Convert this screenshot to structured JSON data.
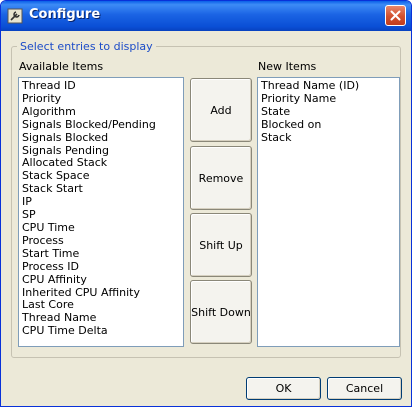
{
  "window": {
    "title": "Configure",
    "icon": "wrench-icon",
    "close_icon": "close-icon"
  },
  "group": {
    "legend": "Select entries to display"
  },
  "available": {
    "label": "Available Items",
    "items": [
      "Thread ID",
      "Priority",
      "Algorithm",
      "Signals Blocked/Pending",
      "Signals Blocked",
      "Signals Pending",
      "Allocated Stack",
      "Stack Space",
      "Stack Start",
      "IP",
      "SP",
      "CPU Time",
      "Process",
      "Start Time",
      "Process ID",
      "CPU Affinity",
      "Inherited CPU Affinity",
      "Last Core",
      "Thread Name",
      "CPU Time Delta"
    ]
  },
  "new_items": {
    "label": "New Items",
    "items": [
      "Thread Name (ID)",
      "Priority Name",
      "State",
      "Blocked on",
      "Stack"
    ]
  },
  "buttons": {
    "add": "Add",
    "remove": "Remove",
    "shift_up": "Shift Up",
    "shift_down": "Shift Down",
    "ok": "OK",
    "cancel": "Cancel"
  },
  "colors": {
    "titlebar": "#0a4fd6",
    "dialog_bg": "#ece9d8",
    "legend_text": "#1c4cc8",
    "close_button": "#d2502e"
  }
}
